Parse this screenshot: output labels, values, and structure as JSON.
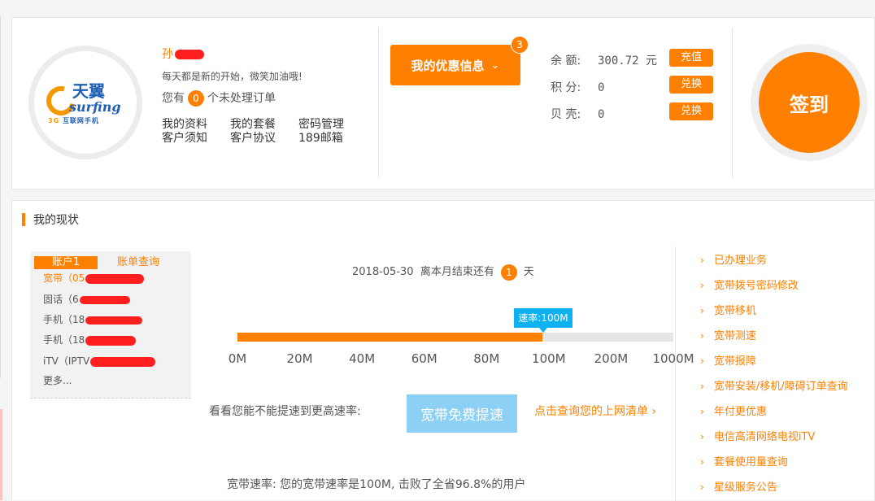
{
  "profile": {
    "name_visible": "孙",
    "motto": "每天都是新的开始，微笑加油哦!",
    "orders_prefix": "您有",
    "orders_count": "0",
    "orders_suffix": "个未处理订单",
    "links": [
      "我的资料",
      "我的套餐",
      "密码管理",
      "客户须知",
      "客户协议",
      "189邮箱"
    ],
    "logo": {
      "brand_cn": "天翼",
      "brand_en": "surfing",
      "tagline_num": "3G",
      "tagline": "互联网手机"
    }
  },
  "promo": {
    "label": "我的优惠信息",
    "badge": "3",
    "chevron_icon": "chevron-down-icon"
  },
  "account": {
    "balance_label": "余  额:",
    "balance_value": "300.72 元",
    "recharge_label": "充值",
    "points_label": "积  分:",
    "points_value": "0",
    "points_redeem_label": "兑换",
    "shells_label": "贝  壳:",
    "shells_value": "0",
    "shells_redeem_label": "兑换"
  },
  "sign_in": {
    "label": "签到"
  },
  "status": {
    "section_title": "我的现状",
    "account_tab": "账户1",
    "bill_query": "账单查询",
    "services": [
      {
        "label": "宽带（05"
      },
      {
        "label": "固话（6"
      },
      {
        "label": "手机（18"
      },
      {
        "label": "手机（18"
      },
      {
        "label": "iTV（IPTV"
      }
    ],
    "more_label": "更多...",
    "date": "2018-05-30",
    "countdown_text": "离本月结束还有",
    "days_left": "1",
    "days_unit": "天",
    "speed_tip": "速率:100M",
    "speed_fill_fraction": 0.7,
    "ticks": [
      "0M",
      "20M",
      "40M",
      "60M",
      "80M",
      "100M",
      "200M",
      "1000M"
    ],
    "accel_question": "看看您能不能提速到更高速率:",
    "accel_button": "宽带免费提速",
    "usage_link": "点击查询您的上网清单",
    "speed_result": "宽带速率: 您的宽带速率是100M, 击败了全省96.8%的用户"
  },
  "sidebar": {
    "items": [
      "已办理业务",
      "宽带拨号密码修改",
      "宽带移机",
      "宽带测速",
      "宽带报障",
      "宽带安装/移机/障碍订单查询",
      "年付更优惠",
      "电信高清网络电视iTV",
      "套餐使用量查询",
      "星级服务公告"
    ]
  },
  "colors": {
    "accent": "#ff7f00",
    "tip_blue": "#0fb2f0",
    "button_blue": "#8dd0f5",
    "redaction": "#ff1f1f"
  }
}
